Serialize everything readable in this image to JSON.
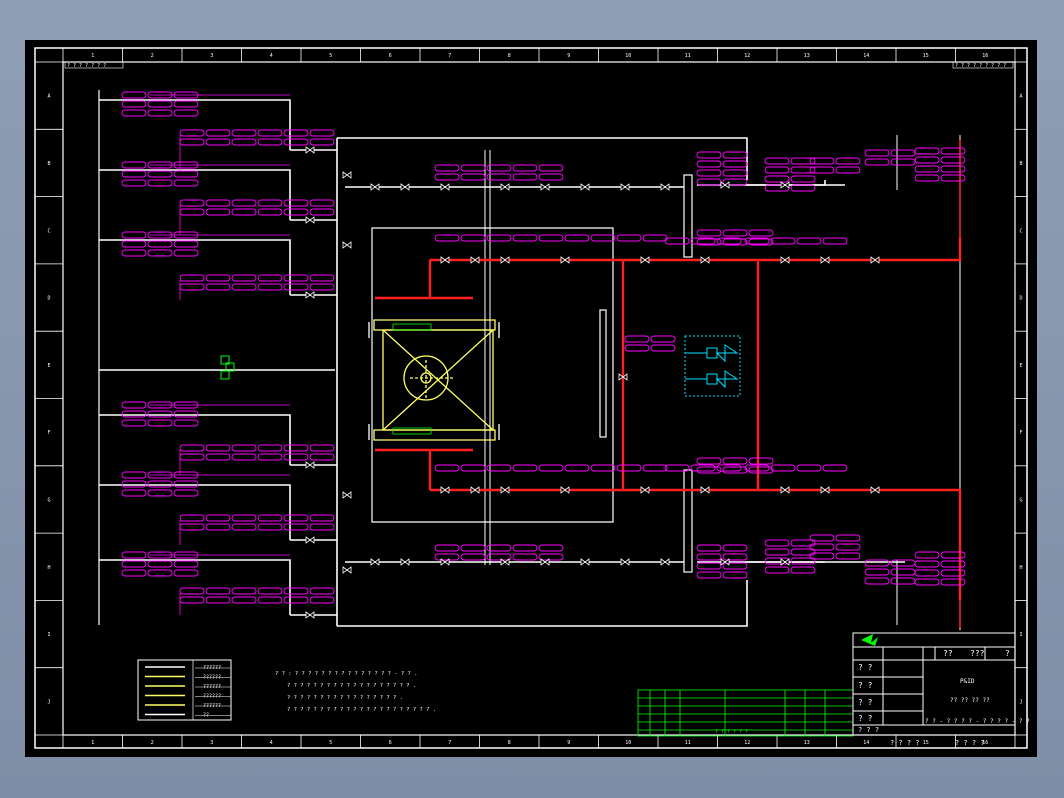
{
  "drawing": {
    "title_lines": [
      "P&ID",
      "?? ?? ?? ??"
    ],
    "title_block": {
      "header_a": "??",
      "header_b": "???",
      "rev_mark": "?",
      "question_marks": [
        "? ?",
        "? ?",
        "? ?",
        "? ?",
        "? ? ?"
      ],
      "drawing_no": "? ? - ? ? ? ? - ? ? ? ? - ? ?",
      "bottom": [
        "? ? ? ?",
        "? ? ? ?"
      ]
    },
    "legend": {
      "items": [
        "??????",
        "??????",
        "??????",
        "??????",
        "??????",
        "??"
      ]
    },
    "notes": [
      "? ? : ? ? ? ? ? ? ? ? ? ? ? ? ? ? ? - ? ? .",
      "? ? ? ? ? ? ? ? ? ? ? ? ? ? ? ? ? ? ? .",
      "? ? ? ? ? ? ? ? ? ? ? ? ? ? ? ? ? .",
      "? ? ? ? ? ? ? ? ? ? ? ? ? ? ? ? ? ? ? ? ? ? ."
    ],
    "border_top_left": "? ? ? ? ? ? ?",
    "border_top_right": "? ? ? ? ? ? ? ? ?",
    "zone_letters": [
      "A",
      "B",
      "C",
      "D",
      "E",
      "F",
      "G",
      "H",
      "I",
      "J"
    ],
    "zone_numbers": [
      "1",
      "2",
      "3",
      "4",
      "5",
      "6",
      "7",
      "8",
      "9",
      "10",
      "11",
      "12",
      "13",
      "14",
      "15",
      "16"
    ]
  },
  "colors": {
    "magenta": "#ff00ff",
    "red": "#ff2020",
    "yellow": "#ffff66",
    "cyan": "#00e0ff",
    "green": "#00ff00",
    "white": "#ffffff"
  }
}
